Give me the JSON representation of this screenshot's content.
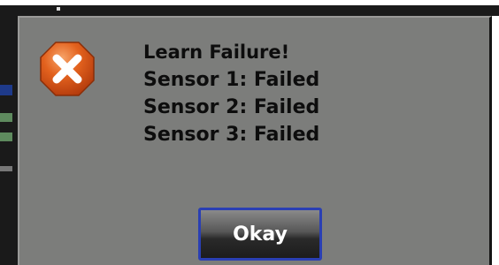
{
  "dialog": {
    "icon": "error-x-icon",
    "lines": [
      "Learn Failure!",
      "Sensor 1: Failed",
      "Sensor 2: Failed",
      "Sensor 3: Failed"
    ],
    "button_label": "Okay"
  },
  "colors": {
    "dialog_bg": "#7c7d7b",
    "icon_fill": "#e05a1a",
    "button_border": "#2a3fb3"
  }
}
